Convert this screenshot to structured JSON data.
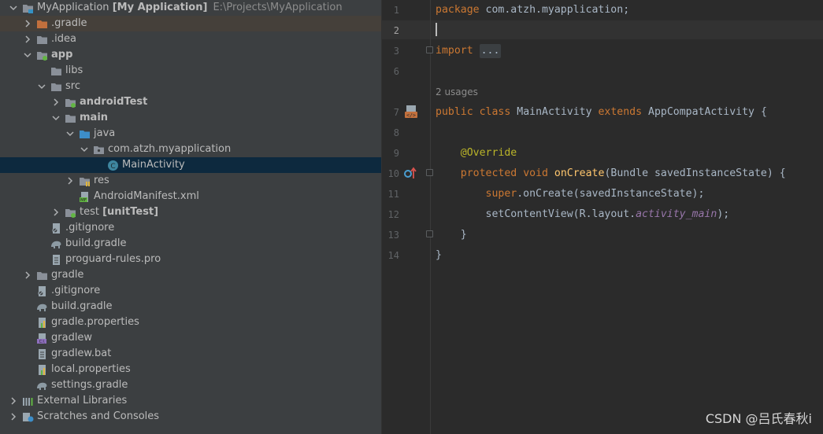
{
  "project_tree": {
    "rows": [
      {
        "label": "MyApplication",
        "bold_suffix": "[My Application]",
        "path": "E:\\Projects\\MyApplication"
      },
      {
        "label": ".gradle"
      },
      {
        "label": ".idea"
      },
      {
        "label": "app"
      },
      {
        "label": "libs"
      },
      {
        "label": "src"
      },
      {
        "label": "androidTest"
      },
      {
        "label": "main"
      },
      {
        "label": "java"
      },
      {
        "label": "com.atzh.myapplication"
      },
      {
        "label": "MainActivity"
      },
      {
        "label": "res"
      },
      {
        "label": "AndroidManifest.xml"
      },
      {
        "label": "test",
        "bold_suffix": "[unitTest]"
      },
      {
        "label": ".gitignore"
      },
      {
        "label": "build.gradle"
      },
      {
        "label": "proguard-rules.pro"
      },
      {
        "label": "gradle"
      },
      {
        "label": ".gitignore"
      },
      {
        "label": "build.gradle"
      },
      {
        "label": "gradle.properties"
      },
      {
        "label": "gradlew"
      },
      {
        "label": "gradlew.bat"
      },
      {
        "label": "local.properties"
      },
      {
        "label": "settings.gradle"
      },
      {
        "label": "External Libraries"
      },
      {
        "label": "Scratches and Consoles"
      }
    ]
  },
  "editor": {
    "line_numbers": [
      "1",
      "2",
      "3",
      "6",
      "7",
      "8",
      "9",
      "10",
      "11",
      "12",
      "13",
      "14"
    ],
    "usages_hint": "2 usages",
    "code": {
      "l1_kw": "package",
      "l1_rest": " com.atzh.myapplication;",
      "l3_kw": "import",
      "l3_fold": "...",
      "l7_kw1": "public",
      "l7_kw2": "class",
      "l7_name": "MainActivity",
      "l7_kw3": "extends",
      "l7_super": "AppCompatActivity",
      "l7_brace": " {",
      "l9_annot": "@Override",
      "l10_kw1": "protected",
      "l10_kw2": "void",
      "l10_fn": "onCreate",
      "l10_args": "(Bundle savedInstanceState) {",
      "l11_kw": "super",
      "l11_rest": ".onCreate(savedInstanceState);",
      "l12_a": "setContentView(R.layout.",
      "l12_it": "activity_main",
      "l12_b": ");",
      "l13": "}",
      "l14": "}"
    },
    "gutter_badge": "</>"
  },
  "watermark": "CSDN @吕氏春秋i",
  "colors": {
    "tree_bg": "#3c3f41",
    "editor_bg": "#2b2b2b",
    "selection": "#0d293e",
    "keyword": "#cc7832",
    "function": "#ffc66d",
    "annotation": "#bbb529",
    "field": "#9876aa",
    "text": "#a9b7c6"
  }
}
